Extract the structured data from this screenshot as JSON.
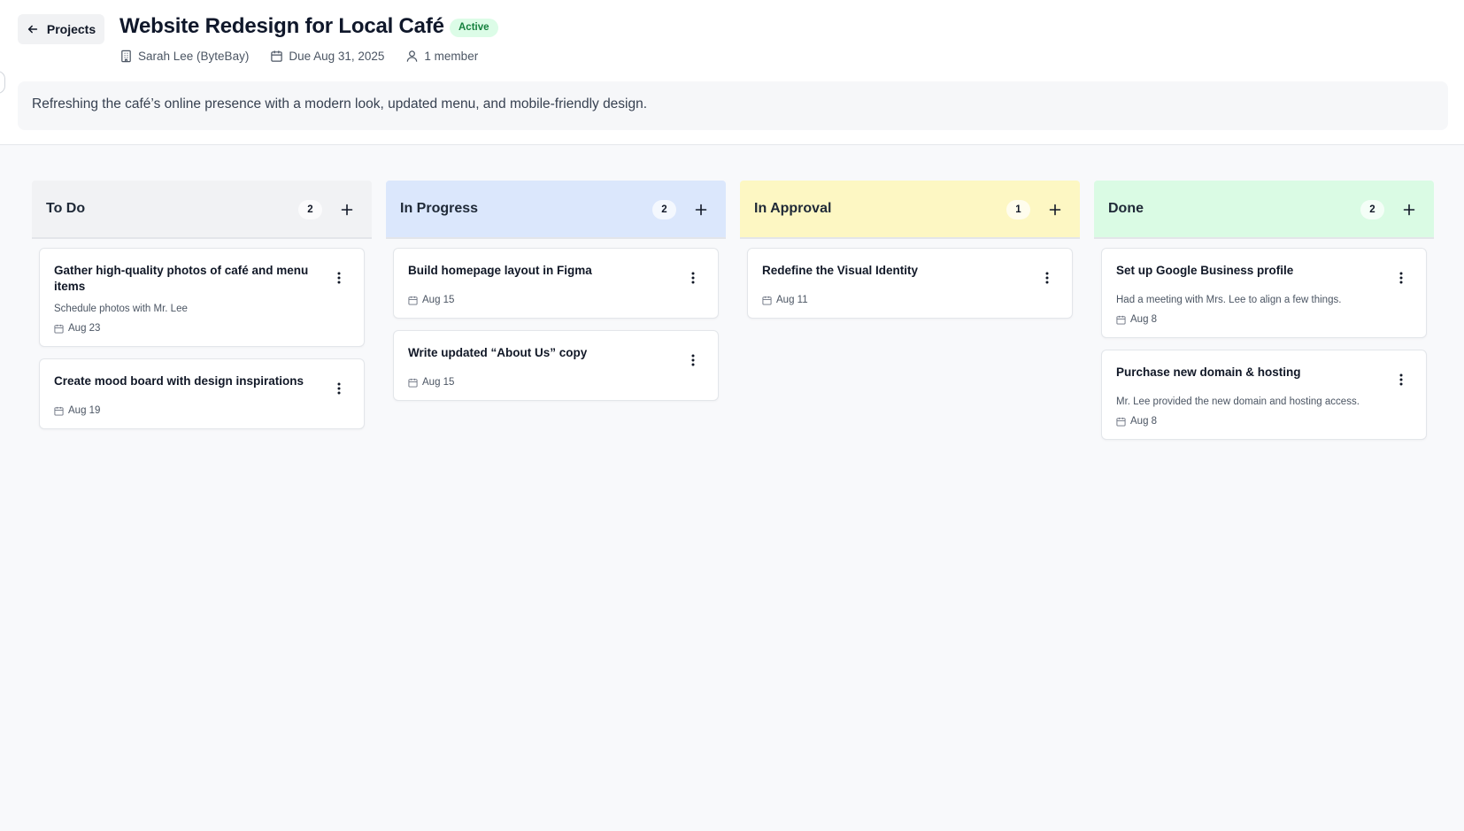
{
  "header": {
    "back_label": "Projects",
    "title": "Website Redesign for Local Café",
    "status": "Active",
    "client": "Sarah Lee (ByteBay)",
    "due": "Due Aug 31, 2025",
    "members": "1 member",
    "description": "Refreshing the café’s online presence with a modern look, updated menu, and mobile-friendly design."
  },
  "colors": {
    "todo": "#f1f2f4",
    "in_progress": "#dbe7fc",
    "in_approval": "#fdf7c3",
    "done": "#dafbe4",
    "status_badge": "#dcfce7"
  },
  "columns": [
    {
      "title": "To Do",
      "count": "2",
      "cards": [
        {
          "title": "Gather high-quality photos of café and menu items",
          "desc": "Schedule photos with Mr. Lee",
          "date": "Aug 23"
        },
        {
          "title": "Create mood board with design inspirations",
          "date": "Aug 19"
        }
      ]
    },
    {
      "title": "In Progress",
      "count": "2",
      "cards": [
        {
          "title": "Build homepage layout in Figma",
          "date": "Aug 15"
        },
        {
          "title": "Write updated “About Us” copy",
          "date": "Aug 15"
        }
      ]
    },
    {
      "title": "In Approval",
      "count": "1",
      "cards": [
        {
          "title": "Redefine the Visual Identity",
          "date": "Aug 11"
        }
      ]
    },
    {
      "title": "Done",
      "count": "2",
      "cards": [
        {
          "title": "Set up Google Business profile",
          "desc": "Had a meeting with Mrs. Lee to align a few things.",
          "date": "Aug 8"
        },
        {
          "title": "Purchase new domain & hosting",
          "desc": "Mr. Lee provided the new domain and hosting access.",
          "date": "Aug 8"
        }
      ]
    }
  ]
}
